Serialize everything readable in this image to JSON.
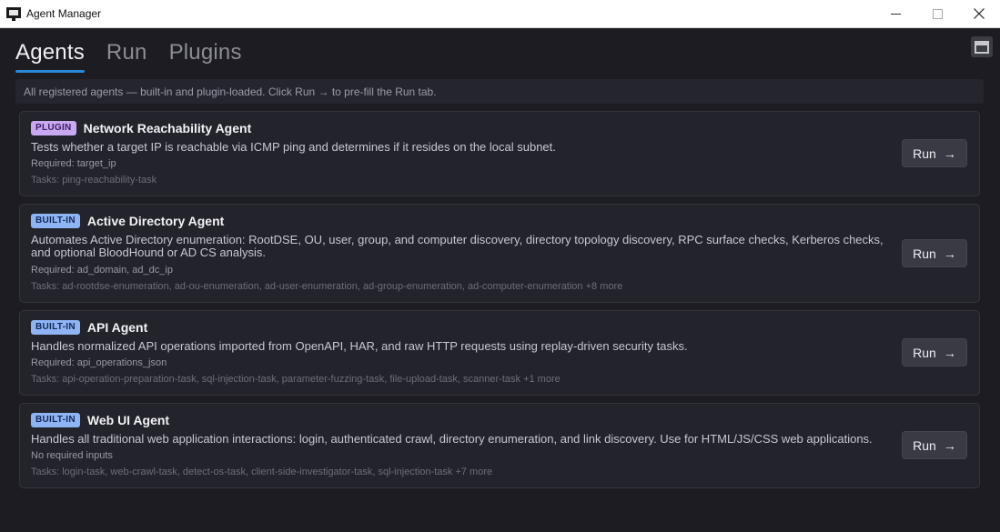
{
  "window": {
    "title": "Agent Manager",
    "controls": [
      "minimize",
      "maximize",
      "close"
    ]
  },
  "tabs": [
    {
      "label": "Agents",
      "active": true
    },
    {
      "label": "Run",
      "active": false
    },
    {
      "label": "Plugins",
      "active": false
    }
  ],
  "layout_toggle_icon": "panel-layout-icon",
  "info": "All registered agents — built-in and plugin-loaded. Click Run → to pre-fill the Run tab.",
  "colors": {
    "accent": "#2b87d8",
    "plugin_badge": "#c9a8f2",
    "builtin_badge": "#8fb4f4",
    "background": "#1c1c22"
  },
  "agents": [
    {
      "badge": "PLUGIN",
      "badge_type": "plugin",
      "name": "Network Reachability Agent",
      "description": "Tests whether a target IP is reachable via ICMP ping and determines if it resides on the local subnet.",
      "required": "Required: target_ip",
      "tasks": "Tasks: ping-reachability-task",
      "run_label": "Run",
      "run_arrow": "→"
    },
    {
      "badge": "BUILT-IN",
      "badge_type": "builtin",
      "name": "Active Directory Agent",
      "description": "Automates Active Directory enumeration: RootDSE, OU, user, group, and computer discovery, directory topology discovery, RPC surface checks, Kerberos checks, and optional BloodHound or AD CS analysis.",
      "required": "Required: ad_domain, ad_dc_ip",
      "tasks": "Tasks: ad-rootdse-enumeration, ad-ou-enumeration, ad-user-enumeration, ad-group-enumeration, ad-computer-enumeration +8 more",
      "run_label": "Run",
      "run_arrow": "→"
    },
    {
      "badge": "BUILT-IN",
      "badge_type": "builtin",
      "name": "API Agent",
      "description": "Handles normalized API operations imported from OpenAPI, HAR, and raw HTTP requests using replay-driven security tasks.",
      "required": "Required: api_operations_json",
      "tasks": "Tasks: api-operation-preparation-task, sql-injection-task, parameter-fuzzing-task, file-upload-task, scanner-task +1 more",
      "run_label": "Run",
      "run_arrow": "→"
    },
    {
      "badge": "BUILT-IN",
      "badge_type": "builtin",
      "name": "Web UI Agent",
      "description": "Handles all traditional web application interactions: login, authenticated crawl, directory enumeration, and link discovery. Use for HTML/JS/CSS web applications.",
      "required": "No required inputs",
      "tasks": "Tasks: login-task, web-crawl-task, detect-os-task, client-side-investigator-task, sql-injection-task +7 more",
      "run_label": "Run",
      "run_arrow": "→"
    }
  ]
}
